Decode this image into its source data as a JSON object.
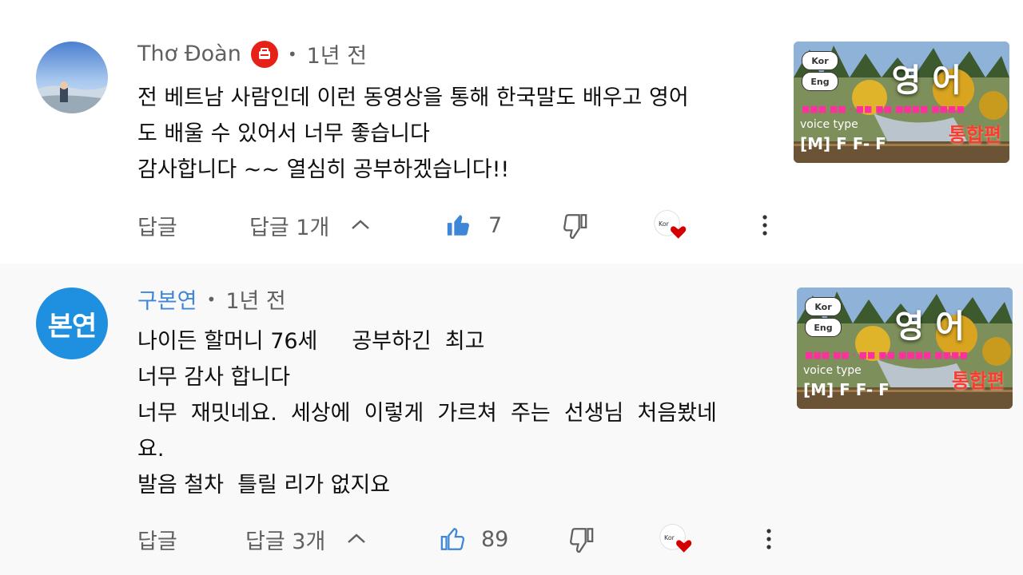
{
  "comments": [
    {
      "author": "Thơ Đoàn",
      "time": "1년 전",
      "lines": [
        "전 베트남 사람인데 이런 동영상을 통해 한국말도 배우고 영어",
        "도 배울 수 있어서 너무 좋습니다",
        "감사합니다 ~~ 열심히 공부하겠습니다!!"
      ],
      "reply_label": "답글",
      "replies_label": "답글 1개",
      "likes": "7",
      "thumbnail": {
        "title": "영 어",
        "sub": "통합편",
        "voice": "voice type",
        "mff": "[M] F F- F",
        "tag1": "Kor",
        "tag2": "Eng"
      }
    },
    {
      "author": "구본연",
      "avatar_text": "본연",
      "time": "1년 전",
      "lines": [
        "나이든 할머니 76세     공부하긴  최고",
        "너무 감사 합니다",
        "너무  재밋네요.  세상에  이렇게  가르쳐  주는  선생님  처음봤네",
        "요.",
        "발음 철차  틀릴 리가 없지요"
      ],
      "reply_label": "답글",
      "replies_label": "답글 3개",
      "likes": "89",
      "thumbnail": {
        "title": "영 어",
        "sub": "통합편",
        "voice": "voice type",
        "mff": "[M] F F- F",
        "tag1": "Kor",
        "tag2": "Eng"
      }
    }
  ],
  "colors": {
    "blue_link": "#3e86d8",
    "like_active": "#3ea6ff",
    "badge_red": "#e62117",
    "heart_red": "#d40000"
  }
}
